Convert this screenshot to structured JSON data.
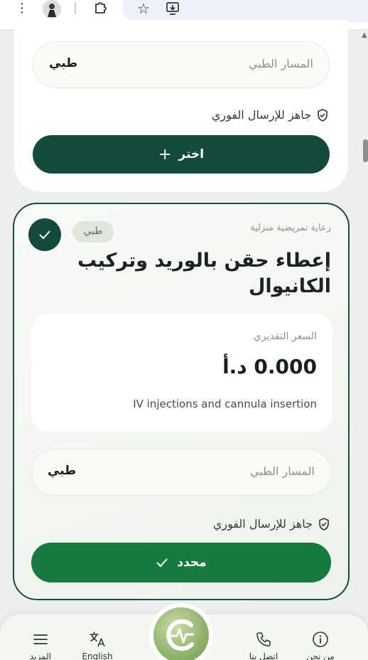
{
  "browser": {
    "menu_glyph": "⋮",
    "star_glyph": "☆"
  },
  "card_top": {
    "path_label": "المسار الطبي",
    "path_value": "طبي",
    "ready_text": "جاهز للإرسال الفوري",
    "choose_button": "اختر",
    "choose_icon": "+"
  },
  "card_selected": {
    "category": "رعاية تمريضية منزلية",
    "tag": "طبي",
    "title": "إعطاء حقن بالوريد وتركيب الكانيوال",
    "price_label": "السعر التقديري",
    "price_value": "0.000 د.أ",
    "description": "IV injections and cannula insertion",
    "path_label": "المسار الطبي",
    "path_value": "طبي",
    "ready_text": "جاهز للإرسال الفوري",
    "selected_button": "محدد"
  },
  "bottom_nav": {
    "items": [
      {
        "label": "المزيد",
        "icon": "menu-icon"
      },
      {
        "label": "English",
        "icon": "translate-icon"
      },
      {
        "label": "اتصل بنا",
        "icon": "phone-icon"
      },
      {
        "label": "من نحن",
        "icon": "info-icon"
      }
    ]
  },
  "colors": {
    "primary_dark": "#14493e",
    "selected_green": "#177a3f",
    "background": "#ecefeb"
  }
}
